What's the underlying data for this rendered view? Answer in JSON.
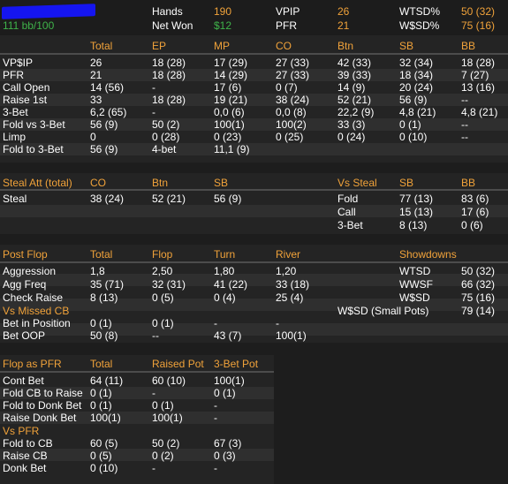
{
  "player": {
    "redacted_name": "",
    "winrate": "111 bb/100"
  },
  "summary": {
    "hands_label": "Hands",
    "hands": "190",
    "netwon_label": "Net Won",
    "netwon": "$12",
    "vpip_label": "VPIP",
    "vpip": "26",
    "pfr_label": "PFR",
    "pfr": "21",
    "wtsd_label": "WTSD%",
    "wtsd": "50 (32)",
    "wsd_label": "W$SD%",
    "wsd": "75 (16)"
  },
  "preflop": {
    "headers": [
      "Total",
      "EP",
      "MP",
      "CO",
      "Btn",
      "SB",
      "BB"
    ],
    "rows": [
      {
        "label": "VP$IP",
        "cells": [
          "26",
          "18 (28)",
          "17 (29)",
          "27 (33)",
          "42 (33)",
          "32 (34)",
          "18 (28)"
        ]
      },
      {
        "label": "PFR",
        "cells": [
          "21",
          "18 (28)",
          "14 (29)",
          "27 (33)",
          "39 (33)",
          "18 (34)",
          "7 (27)"
        ]
      },
      {
        "label": "Call Open",
        "cells": [
          "14 (56)",
          "-",
          "17 (6)",
          "0 (7)",
          "14 (9)",
          "20 (24)",
          "13 (16)"
        ]
      },
      {
        "label": "Raise 1st",
        "cells": [
          "33",
          "18 (28)",
          "19 (21)",
          "38 (24)",
          "52 (21)",
          "56 (9)",
          "--"
        ]
      },
      {
        "label": "3-Bet",
        "cells": [
          "6,2 (65)",
          "-",
          "0,0 (6)",
          "0,0 (8)",
          "22,2 (9)",
          "4,8 (21)",
          "4,8 (21)"
        ]
      },
      {
        "label": "Fold vs 3-Bet",
        "cells": [
          "56 (9)",
          "50 (2)",
          "100(1)",
          "100(2)",
          "33 (3)",
          "0 (1)",
          "--"
        ]
      },
      {
        "label": "Limp",
        "cells": [
          "0",
          "0 (28)",
          "0 (23)",
          "0 (25)",
          "0 (24)",
          "0 (10)",
          "--"
        ]
      },
      {
        "label": "Fold to 3-Bet",
        "cells": [
          "56 (9)",
          "4-bet",
          "11,1 (9)",
          "",
          "",
          "",
          ""
        ]
      }
    ]
  },
  "steal": {
    "title": "Steal Att (total)",
    "headers": [
      "CO",
      "Btn",
      "SB"
    ],
    "row_label": "Steal",
    "cells": [
      "38 (24)",
      "52 (21)",
      "56 (9)"
    ],
    "vs_title": "Vs Steal",
    "vs_headers": [
      "SB",
      "BB"
    ],
    "vs_rows": [
      {
        "label": "Fold",
        "cells": [
          "77 (13)",
          "83 (6)"
        ]
      },
      {
        "label": "Call",
        "cells": [
          "15 (13)",
          "17 (6)"
        ]
      },
      {
        "label": "3-Bet",
        "cells": [
          "8 (13)",
          "0 (6)"
        ]
      }
    ]
  },
  "postflop": {
    "title": "Post Flop",
    "headers": [
      "Total",
      "Flop",
      "Turn",
      "River"
    ],
    "rows": [
      {
        "label": "Aggression",
        "cells": [
          "1,8",
          "2,50",
          "1,80",
          "1,20"
        ]
      },
      {
        "label": "Agg Freq",
        "cells": [
          "35 (71)",
          "32 (31)",
          "41 (22)",
          "33 (18)"
        ]
      },
      {
        "label": "Check Raise",
        "cells": [
          "8 (13)",
          "0 (5)",
          "0 (4)",
          "25 (4)"
        ]
      }
    ],
    "missed_title": "Vs Missed CB",
    "missed_rows": [
      {
        "label": "Bet in Position",
        "cells": [
          "0 (1)",
          "0 (1)",
          "-",
          "-"
        ]
      },
      {
        "label": "Bet OOP",
        "cells": [
          "50 (8)",
          "--",
          "43 (7)",
          "100(1)"
        ]
      }
    ],
    "showdowns_title": "Showdowns",
    "showdowns": [
      {
        "label": "WTSD",
        "value": "50 (32)"
      },
      {
        "label": "WWSF",
        "value": "66 (32)"
      },
      {
        "label": "W$SD",
        "value": "75 (16)"
      },
      {
        "label": "W$SD (Small Pots)",
        "value": "79 (14)"
      }
    ]
  },
  "flop_pfr": {
    "title": "Flop as PFR",
    "headers": [
      "Total",
      "Raised Pot",
      "3-Bet Pot"
    ],
    "rows": [
      {
        "label": "Cont Bet",
        "cells": [
          "64 (11)",
          "60 (10)",
          "100(1)"
        ]
      },
      {
        "label": "Fold CB to Raise",
        "cells": [
          "0 (1)",
          "-",
          "0 (1)"
        ]
      },
      {
        "label": "Fold to Donk Bet",
        "cells": [
          "0 (1)",
          "0 (1)",
          "-"
        ]
      },
      {
        "label": "Raise Donk Bet",
        "cells": [
          "100(1)",
          "100(1)",
          "-"
        ]
      }
    ],
    "vs_title": "Vs PFR",
    "vs_rows": [
      {
        "label": "Fold to CB",
        "cells": [
          "60 (5)",
          "50 (2)",
          "67 (3)"
        ]
      },
      {
        "label": "Raise CB",
        "cells": [
          "0 (5)",
          "0 (2)",
          "0 (3)"
        ]
      },
      {
        "label": "Donk Bet",
        "cells": [
          "0 (10)",
          "-",
          "-"
        ]
      }
    ]
  }
}
